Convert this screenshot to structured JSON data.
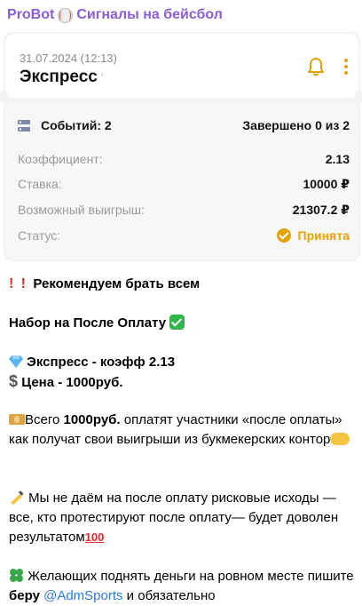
{
  "header": {
    "channel_name": "ProBot",
    "channel_subtitle": "Сигналы на бейсбол",
    "ball_icon": "baseball-icon"
  },
  "ticket": {
    "date": "31.07.2024 (12:13)",
    "type": "Экспресс",
    "type_marker": "'",
    "events_label": "Событий: 2",
    "completed_label": "Завершено 0 из 2",
    "rows": [
      {
        "label": "Коэффициент:",
        "value": "2.13"
      },
      {
        "label": "Ставка:",
        "value": "10000 ₽"
      },
      {
        "label": "Возможный выигрыш:",
        "value": "21307.2 ₽"
      }
    ],
    "status_label": "Статус:",
    "status_value": "Принята",
    "accent_color": "#e3a400"
  },
  "post": {
    "line1": "Рекомендуем брать всем",
    "line2": "Набор на После Оплату",
    "line3": "Экспресс - коэфф 2.13",
    "line4": "Цена - 1000руб.",
    "p3_a": "Всего ",
    "p3_b": "1000руб.",
    "p3_c": " оплатят участники «после оплаты» как получат свои выигрыши из букмекерских контор",
    "p4": " Мы не даём на после оплату рисковые исходы — все, кто протестируют после оплату— будет доволен результатом",
    "hundred": "100",
    "p5_a": " Желающих поднять деньги на ровном месте пишите ",
    "p5_b": "беру",
    "p5_link": "@AdmSports",
    "p5_c": " и обязательно"
  }
}
